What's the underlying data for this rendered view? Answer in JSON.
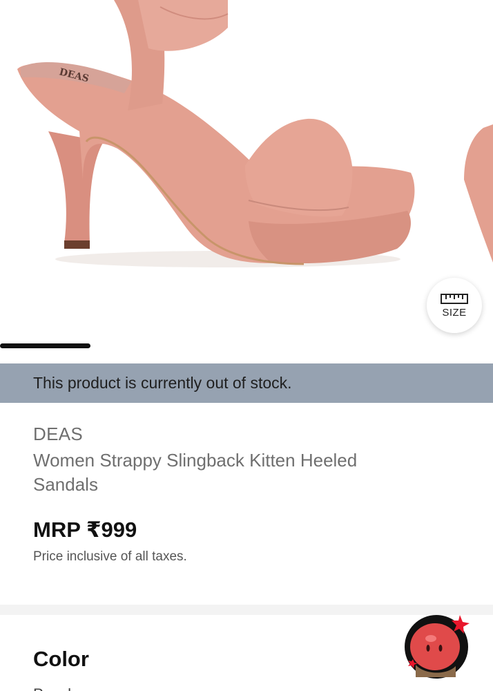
{
  "product_image": {
    "brand_print": "DEAS",
    "size_button_label": "SIZE",
    "carousel_index": 1
  },
  "stock_banner": {
    "message": "This product is currently out of stock."
  },
  "product": {
    "brand": "DEAS",
    "title": "Women Strappy Slingback Kitten Heeled Sandals",
    "price": "MRP ₹999",
    "tax_note": "Price inclusive of all taxes."
  },
  "color_section": {
    "heading": "Color",
    "value": "Peach"
  },
  "colors": {
    "banner": "#96a2b1",
    "shoe": "#e3a090",
    "accent": "#e8172c"
  }
}
